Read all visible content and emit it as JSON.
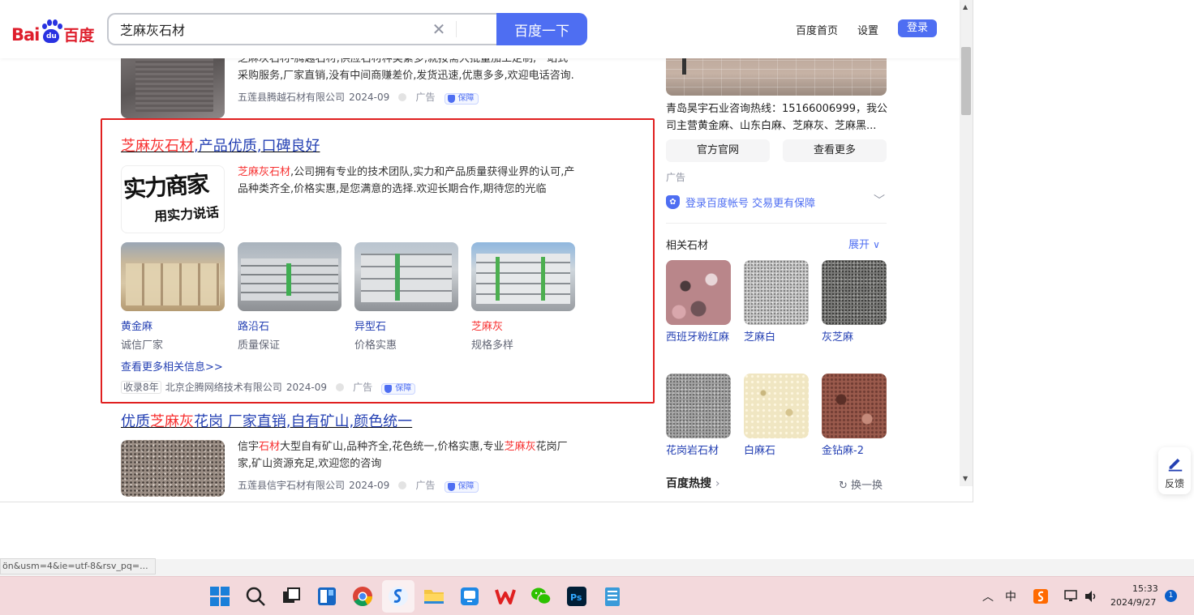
{
  "header": {
    "logo_text": "Bai",
    "logo_du": "du",
    "logo_cn": "百度",
    "search_value": "芝麻灰石材",
    "search_button": "百度一下",
    "links": [
      "百度首页",
      "设置"
    ],
    "login": "登录"
  },
  "results": {
    "r0": {
      "desc_top_line": "芝麻灰石材-腾越石材,供应石材种类繁多,就按需大批量加工定制,一站式",
      "desc": "采购服务,厂家直销,没有中间商赚差价,发货迅速,优惠多多,欢迎电话咨询.",
      "company": "五莲县腾越石材有限公司",
      "date": "2024-09",
      "ad": "广告",
      "badge": "保障"
    },
    "r1": {
      "title_red": "芝麻灰石材",
      "title_rest": ",产品优质,口碑良好",
      "logo_line1": "实力商家",
      "logo_line2": "用实力说话",
      "desc_red": "芝麻灰石材",
      "desc_rest": ",公司拥有专业的技术团队,实力和产品质量获得业界的认可,产",
      "desc_line2": "品种类齐全,价格实惠,是您满意的选择.欢迎长期合作,期待您的光临",
      "cards": [
        {
          "name": "黄金麻",
          "sub": "诚信厂家"
        },
        {
          "name": "路沿石",
          "sub": "质量保证"
        },
        {
          "name": "异型石",
          "sub": "价格实惠"
        },
        {
          "name": "芝麻灰",
          "sub": "规格多样"
        }
      ],
      "more": "查看更多相关信息>>",
      "years": "收录8年",
      "company": "北京企腾网络技术有限公司",
      "date": "2024-09",
      "ad": "广告",
      "badge": "保障"
    },
    "r2": {
      "title_a": "优质",
      "title_red": "芝麻灰",
      "title_b": "花岗 厂家直销,自有矿山,颜色统一",
      "desc_a": "信宇",
      "desc_red1": "石材",
      "desc_b": "大型自有矿山,品种齐全,花色统一,价格实惠,专业",
      "desc_red2": "芝麻灰",
      "desc_c": "花岗厂",
      "desc_line2": "家,矿山资源充足,欢迎您的咨询",
      "company": "五莲县信宇石材有限公司",
      "date": "2024-09",
      "ad": "广告",
      "badge": "保障"
    }
  },
  "sidebar": {
    "ad_desc_line1": "青岛昊宇石业咨询热线：15166006999，我公",
    "ad_desc_line2": "司主营黄金麻、山东白麻、芝麻灰、芝麻黑...",
    "btn_official": "官方官网",
    "btn_more": "查看更多",
    "ad_label": "广告",
    "login_hint": "登录百度帐号 交易更有保障",
    "related_title": "相关石材",
    "expand": "展开",
    "related": [
      "西班牙粉红麻",
      "芝麻白",
      "灰芝麻",
      "花岗岩石材",
      "白麻石",
      "金钻麻-2"
    ],
    "hot_title": "百度热搜",
    "refresh": "换一换"
  },
  "feedback": "反馈",
  "status_url": "ön&usm=4&ie=utf-8&rsv_pq=...",
  "taskbar": {
    "ime": "中",
    "time": "15:33",
    "date": "2024/9/27",
    "notifications": "1"
  }
}
